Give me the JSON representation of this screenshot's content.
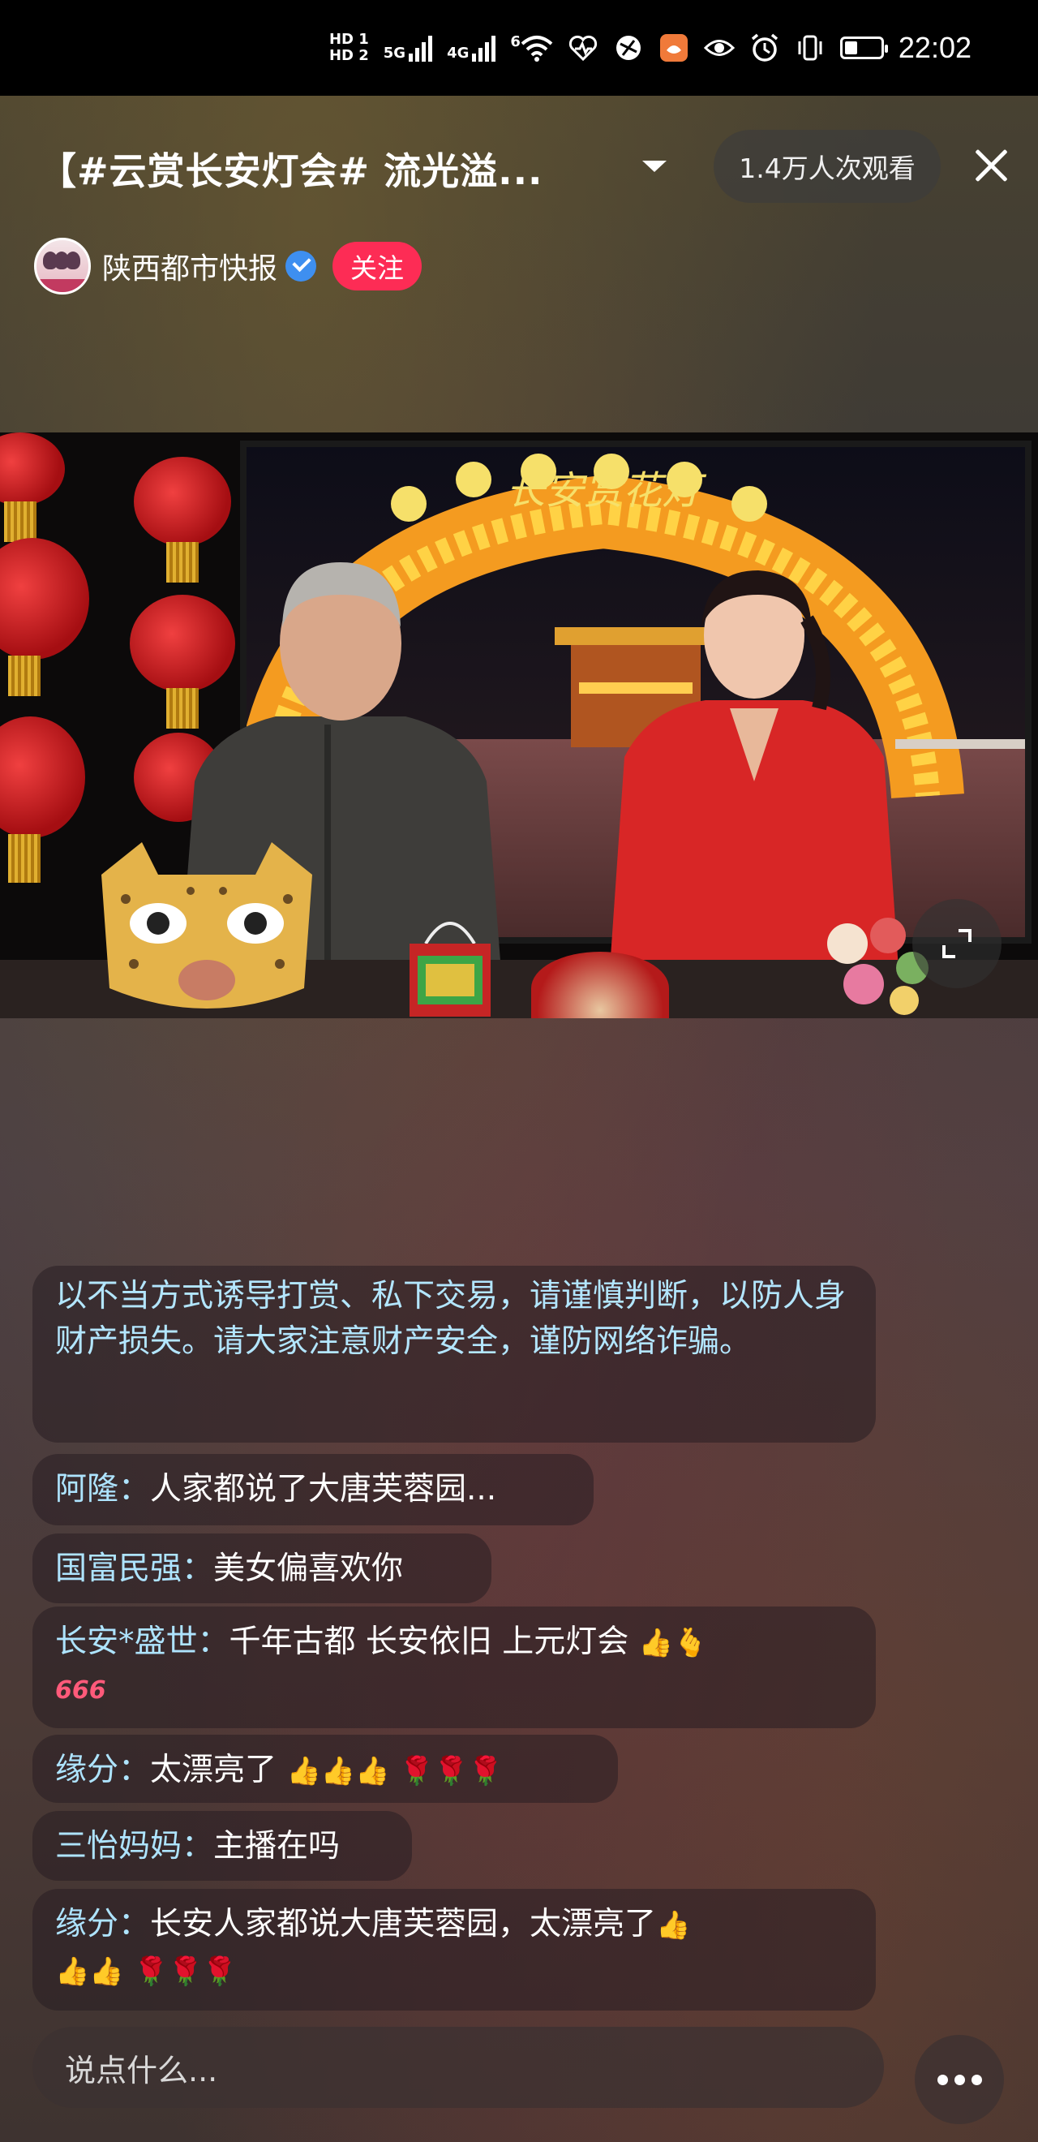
{
  "status_bar": {
    "hd1": "HD 1",
    "hd2": "HD 2",
    "net1": "5G",
    "net2": "4G",
    "wifi_sup": "6",
    "time": "22:02",
    "icons": [
      "signal-icon",
      "signal-icon",
      "wifi-icon",
      "health-icon",
      "vpn-icon",
      "app-icon",
      "eye-icon",
      "alarm-icon",
      "vibrate-icon",
      "battery-icon"
    ],
    "battery_level": 0.35
  },
  "header": {
    "title": "【#云赏长安灯会# 流光溢...",
    "viewers": "1.4万人次观看",
    "anchor_name": "陕西都市快报",
    "follow_label": "关注"
  },
  "video": {
    "banner_text": "长安赏花灯"
  },
  "chat": {
    "notice": "以不当方式诱导打赏、私下交易，请谨慎判断，以防人身财产损失。请大家注意财产安全，谨防网络诈骗。",
    "messages": [
      {
        "user": "阿隆：",
        "text": "人家都说了大唐芙蓉园..."
      },
      {
        "user": "国富民强：",
        "text": "美女偏喜欢你"
      },
      {
        "user": "长安*盛世：",
        "text": "千年古都 长安依旧 上元灯会"
      },
      {
        "user": "缘分：",
        "text": "太漂亮了"
      },
      {
        "user": "三怡妈妈：",
        "text": "主播在吗"
      },
      {
        "user": "缘分：",
        "text": "长安人家都说大唐芙蓉园，太漂亮了"
      }
    ],
    "emoji": {
      "thumb": "👍",
      "heart_hand": "🫰",
      "rose": "🌹",
      "six": "666"
    }
  },
  "input": {
    "placeholder": "说点什么..."
  },
  "colors": {
    "follow": "#fd2c55",
    "user_name": "#aee4ff",
    "verified": "#3e8ff0"
  }
}
